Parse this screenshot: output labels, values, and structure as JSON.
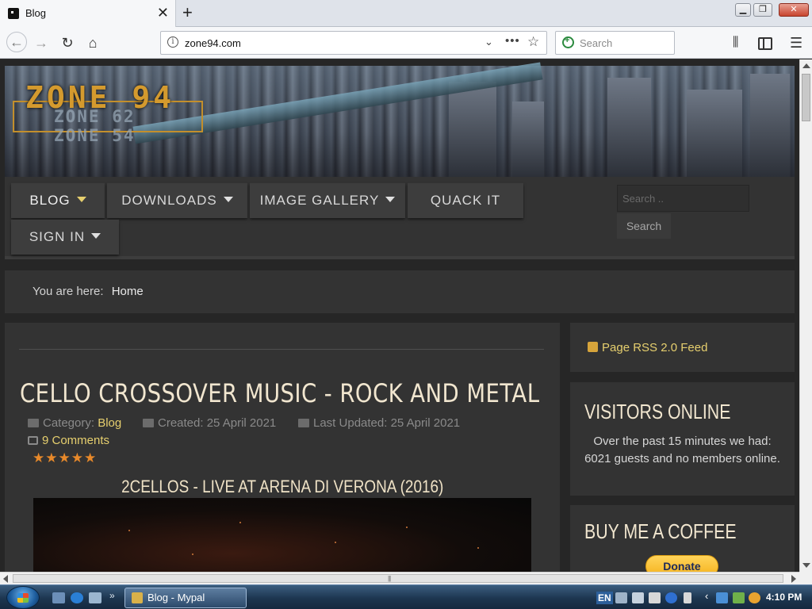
{
  "browser": {
    "tab_title": "Blog",
    "url": "zone94.com",
    "search_placeholder": "Search"
  },
  "site": {
    "logo_main": "ZONE 94",
    "logo_sub_1": "ZONE 62",
    "logo_sub_2": "ZONE 54",
    "menu": [
      {
        "label": "BLOG"
      },
      {
        "label": "DOWNLOADS"
      },
      {
        "label": "IMAGE GALLERY"
      },
      {
        "label": "QUACK IT"
      },
      {
        "label": "SIGN IN"
      }
    ],
    "search_placeholder": "Search ..",
    "search_button": "Search",
    "breadcrumb_prefix": "You are here:",
    "breadcrumb_home": "Home"
  },
  "article": {
    "title": "CELLO CROSSOVER MUSIC - ROCK AND METAL",
    "category_label": "Category:",
    "category": "Blog",
    "created": "Created: 25 April 2021",
    "updated": "Last Updated: 25 April 2021",
    "comments": "9 Comments",
    "rating_stars": "★★★★★",
    "video_title": "2CELLOS - LIVE AT ARENA DI VERONA (2016)"
  },
  "sidebar": {
    "rss": "Page RSS 2.0 Feed",
    "visitors_title": "VISITORS ONLINE",
    "visitors_text": "Over the past 15 minutes we had: 6021 guests and no members online.",
    "coffee_title": "BUY ME A COFFEE",
    "donate": "Donate"
  },
  "taskbar": {
    "task_label": "Blog - Mypal",
    "language": "EN",
    "clock": "4:10 PM"
  },
  "colors": {
    "accent_gold": "#e6cf6e",
    "logo_orange": "#d49a2e",
    "star_orange": "#e8892a"
  }
}
